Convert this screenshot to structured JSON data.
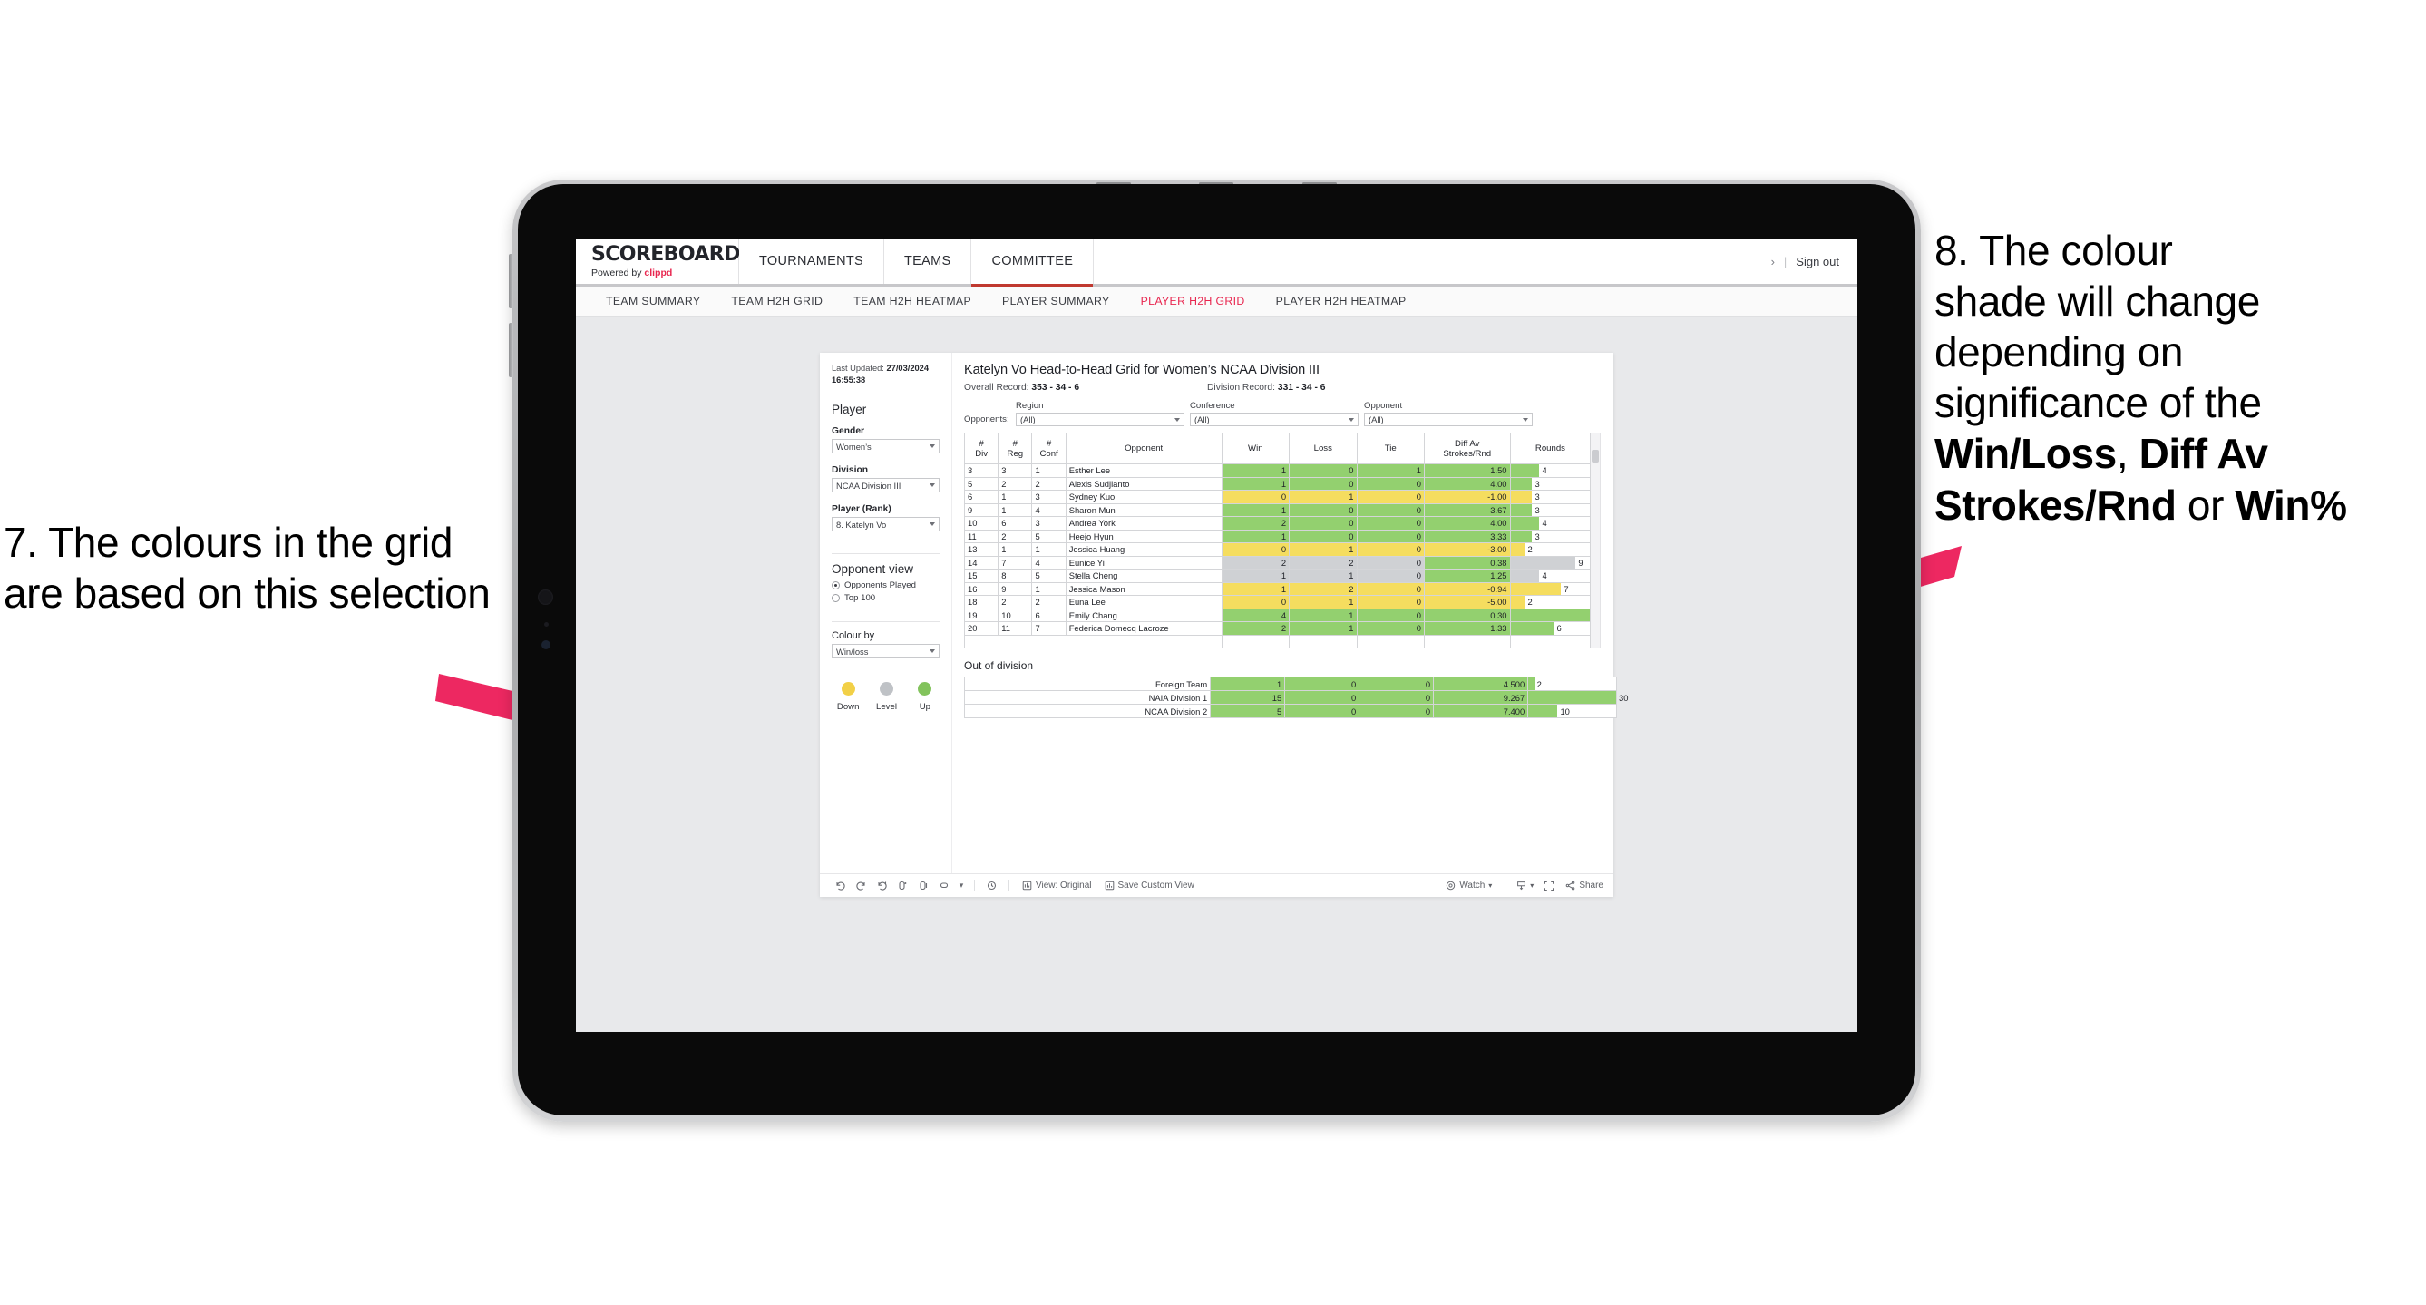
{
  "annotations": {
    "left": {
      "id": "7",
      "text": "7. The colours in the grid are based on this selection"
    },
    "right": {
      "id": "8",
      "line1": "8. The colour",
      "line2": "shade will change",
      "line3": "depending on",
      "line4": "significance of the",
      "bold1": "Win/Loss",
      "mid1": ", ",
      "bold2": "Diff Av Strokes/Rnd",
      "mid2": " or ",
      "bold3": "Win%"
    },
    "arrow_color": "#ed2861"
  },
  "app": {
    "brand": {
      "title": "SCOREBOARD",
      "powered_prefix": "Powered by ",
      "powered_name": "clippd"
    },
    "main_nav": [
      {
        "label": "TOURNAMENTS",
        "active": false
      },
      {
        "label": "TEAMS",
        "active": false
      },
      {
        "label": "COMMITTEE",
        "active": true
      }
    ],
    "top_right": {
      "chevron": "›",
      "separator": "|",
      "sign_out": "Sign out"
    },
    "sub_nav": [
      {
        "label": "TEAM SUMMARY",
        "active": false
      },
      {
        "label": "TEAM H2H GRID",
        "active": false
      },
      {
        "label": "TEAM H2H HEATMAP",
        "active": false
      },
      {
        "label": "PLAYER SUMMARY",
        "active": false
      },
      {
        "label": "PLAYER H2H GRID",
        "active": true
      },
      {
        "label": "PLAYER H2H HEATMAP",
        "active": false
      }
    ]
  },
  "sidebar": {
    "last_updated_label": "Last Updated:",
    "last_updated_date": "27/03/2024",
    "last_updated_time": "16:55:38",
    "player_heading": "Player",
    "gender": {
      "label": "Gender",
      "value": "Women’s"
    },
    "division": {
      "label": "Division",
      "value": "NCAA Division III"
    },
    "player_rank": {
      "label": "Player (Rank)",
      "value": "8. Katelyn Vo"
    },
    "opponent_view": {
      "heading": "Opponent view",
      "options": [
        {
          "label": "Opponents Played",
          "selected": true
        },
        {
          "label": "Top 100",
          "selected": false
        }
      ]
    },
    "colour_by": {
      "label": "Colour by",
      "value": "Win/loss"
    },
    "legend": [
      {
        "label": "Down",
        "color": "#f2d047"
      },
      {
        "label": "Level",
        "color": "#bfc2c6"
      },
      {
        "label": "Up",
        "color": "#82c35c"
      }
    ]
  },
  "viz": {
    "title": "Katelyn Vo Head-to-Head Grid for Women’s NCAA Division III",
    "overall_record_label": "Overall Record:",
    "overall_record_value": "353 -  34 - 6",
    "division_record_label": "Division Record:",
    "division_record_value": "331 -  34 - 6",
    "opponents_label": "Opponents:",
    "filters": [
      {
        "caption": "Region",
        "value": "(All)"
      },
      {
        "caption": "Conference",
        "value": "(All)"
      },
      {
        "caption": "Opponent",
        "value": "(All)"
      }
    ],
    "out_of_division_title": "Out of division"
  },
  "chart_data": {
    "type": "table",
    "title": "Katelyn Vo Head-to-Head Grid for Women’s NCAA Division III",
    "columns": [
      "# Div",
      "# Reg",
      "# Conf",
      "Opponent",
      "Win",
      "Loss",
      "Tie",
      "Diff Av Strokes/Rnd",
      "Rounds"
    ],
    "headers_two_line": [
      {
        "top": "#",
        "bottom": "Div"
      },
      {
        "top": "#",
        "bottom": "Reg"
      },
      {
        "top": "#",
        "bottom": "Conf"
      },
      {
        "top": "Opponent",
        "bottom": ""
      },
      {
        "top": "Win",
        "bottom": ""
      },
      {
        "top": "Loss",
        "bottom": ""
      },
      {
        "top": "Tie",
        "bottom": ""
      },
      {
        "top": "Diff Av",
        "bottom": "Strokes/Rnd"
      },
      {
        "top": "Rounds",
        "bottom": ""
      }
    ],
    "colors": {
      "up": "#93d06f",
      "down": "#f5dd5f",
      "level": "#cfd1d4"
    },
    "rounds_max": 11,
    "rows": [
      {
        "div": "3",
        "reg": "3",
        "conf": "1",
        "opponent": "Esther Lee",
        "win": "1",
        "loss": "0",
        "tie": "1",
        "diff": "1.50",
        "rounds": "4",
        "state": "up"
      },
      {
        "div": "5",
        "reg": "2",
        "conf": "2",
        "opponent": "Alexis Sudjianto",
        "win": "1",
        "loss": "0",
        "tie": "0",
        "diff": "4.00",
        "rounds": "3",
        "state": "up"
      },
      {
        "div": "6",
        "reg": "1",
        "conf": "3",
        "opponent": "Sydney Kuo",
        "win": "0",
        "loss": "1",
        "tie": "0",
        "diff": "-1.00",
        "rounds": "3",
        "state": "down"
      },
      {
        "div": "9",
        "reg": "1",
        "conf": "4",
        "opponent": "Sharon Mun",
        "win": "1",
        "loss": "0",
        "tie": "0",
        "diff": "3.67",
        "rounds": "3",
        "state": "up"
      },
      {
        "div": "10",
        "reg": "6",
        "conf": "3",
        "opponent": "Andrea York",
        "win": "2",
        "loss": "0",
        "tie": "0",
        "diff": "4.00",
        "rounds": "4",
        "state": "up"
      },
      {
        "div": "11",
        "reg": "2",
        "conf": "5",
        "opponent": "Heejo Hyun",
        "win": "1",
        "loss": "0",
        "tie": "0",
        "diff": "3.33",
        "rounds": "3",
        "state": "up"
      },
      {
        "div": "13",
        "reg": "1",
        "conf": "1",
        "opponent": "Jessica Huang",
        "win": "0",
        "loss": "1",
        "tie": "0",
        "diff": "-3.00",
        "rounds": "2",
        "state": "down"
      },
      {
        "div": "14",
        "reg": "7",
        "conf": "4",
        "opponent": "Eunice Yi",
        "win": "2",
        "loss": "2",
        "tie": "0",
        "diff": "0.38",
        "rounds": "9",
        "state": "level",
        "diff_state": "up"
      },
      {
        "div": "15",
        "reg": "8",
        "conf": "5",
        "opponent": "Stella Cheng",
        "win": "1",
        "loss": "1",
        "tie": "0",
        "diff": "1.25",
        "rounds": "4",
        "state": "level",
        "diff_state": "up"
      },
      {
        "div": "16",
        "reg": "9",
        "conf": "1",
        "opponent": "Jessica Mason",
        "win": "1",
        "loss": "2",
        "tie": "0",
        "diff": "-0.94",
        "rounds": "7",
        "state": "down"
      },
      {
        "div": "18",
        "reg": "2",
        "conf": "2",
        "opponent": "Euna Lee",
        "win": "0",
        "loss": "1",
        "tie": "0",
        "diff": "-5.00",
        "rounds": "2",
        "state": "down"
      },
      {
        "div": "19",
        "reg": "10",
        "conf": "6",
        "opponent": "Emily Chang",
        "win": "4",
        "loss": "1",
        "tie": "0",
        "diff": "0.30",
        "rounds": "11",
        "state": "up"
      },
      {
        "div": "20",
        "reg": "11",
        "conf": "7",
        "opponent": "Federica Domecq Lacroze",
        "win": "2",
        "loss": "1",
        "tie": "0",
        "diff": "1.33",
        "rounds": "6",
        "state": "up"
      }
    ],
    "out_of_division": {
      "rounds_max": 30,
      "rows": [
        {
          "name": "Foreign Team",
          "win": "1",
          "loss": "0",
          "tie": "0",
          "diff": "4.500",
          "rounds": "2",
          "state": "up"
        },
        {
          "name": "NAIA Division 1",
          "win": "15",
          "loss": "0",
          "tie": "0",
          "diff": "9.267",
          "rounds": "30",
          "state": "up"
        },
        {
          "name": "NCAA Division 2",
          "win": "5",
          "loss": "0",
          "tie": "0",
          "diff": "7.400",
          "rounds": "10",
          "state": "up"
        }
      ]
    }
  },
  "toolbar": {
    "icons": [
      {
        "name": "undo-icon"
      },
      {
        "name": "redo-icon"
      },
      {
        "name": "revert-icon"
      },
      {
        "name": "refresh-icon"
      },
      {
        "name": "pause-icon"
      },
      {
        "name": "alerts-icon"
      }
    ],
    "dropdown_caret": "▾",
    "history_icon": "history-icon",
    "view_original": "View: Original",
    "save_custom_view": "Save Custom View",
    "watch": "Watch",
    "share": "Share"
  }
}
